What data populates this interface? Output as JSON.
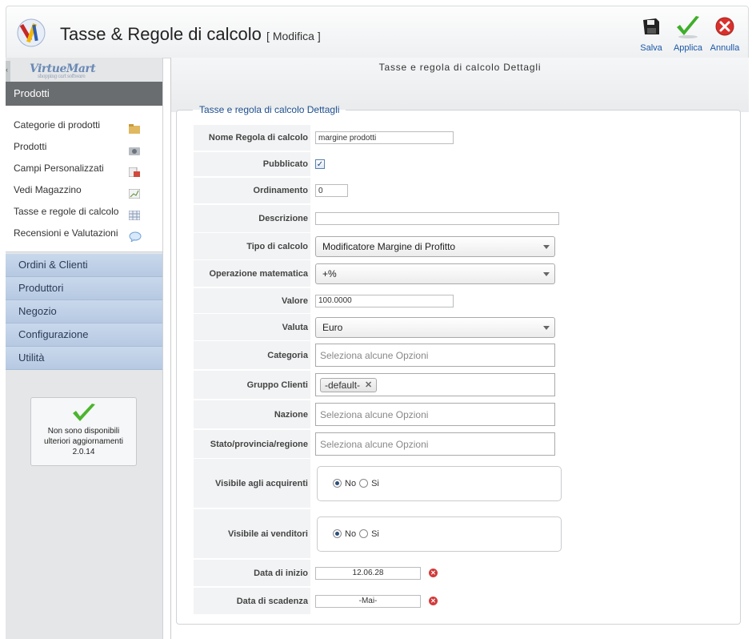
{
  "header": {
    "title": "Tasse & Regole di calcolo",
    "mode": "[ Modifica ]",
    "toolbar": {
      "save_label": "Salva",
      "apply_label": "Applica",
      "cancel_label": "Annulla"
    }
  },
  "sidebar": {
    "logo_text": "VirtueMart",
    "logo_tagline": "shopping cart software",
    "active_section": "Prodotti",
    "items": [
      {
        "label": "Categorie di prodotti",
        "icon": "folder-icon"
      },
      {
        "label": "Prodotti",
        "icon": "camera-icon"
      },
      {
        "label": "Campi Personalizzati",
        "icon": "custom-fields-icon"
      },
      {
        "label": "Vedi Magazzino",
        "icon": "chart-icon"
      },
      {
        "label": "Tasse e regole di calcolo",
        "icon": "calculator-icon"
      },
      {
        "label": "Recensioni e Valutazioni",
        "icon": "speech-bubble-icon"
      }
    ],
    "sections": [
      "Ordini & Clienti",
      "Produttori",
      "Negozio",
      "Configurazione",
      "Utilità"
    ],
    "update_box": {
      "line1": "Non sono disponibili",
      "line2": "ulteriori aggiornamenti",
      "version": "2.0.14"
    }
  },
  "main": {
    "heading": "Tasse e regola di calcolo Dettagli",
    "legend": "Tasse e regola di calcolo Dettagli",
    "form": {
      "name": {
        "label": "Nome Regola di calcolo",
        "value": "margine prodotti"
      },
      "published": {
        "label": "Pubblicato",
        "checked": true
      },
      "ordering": {
        "label": "Ordinamento",
        "value": "0"
      },
      "description": {
        "label": "Descrizione",
        "value": ""
      },
      "calc_type": {
        "label": "Tipo di calcolo",
        "value": "Modificatore Margine di Profitto"
      },
      "math_op": {
        "label": "Operazione matematica",
        "value": "+%"
      },
      "value": {
        "label": "Valore",
        "value": "100.0000"
      },
      "currency": {
        "label": "Valuta",
        "value": "Euro"
      },
      "category": {
        "label": "Categoria",
        "placeholder": "Seleziona alcune Opzioni"
      },
      "shopper_group": {
        "label": "Gruppo Clienti",
        "tag": "-default-"
      },
      "country": {
        "label": "Nazione",
        "placeholder": "Seleziona alcune Opzioni"
      },
      "state": {
        "label": "Stato/provincia/regione",
        "placeholder": "Seleziona alcune Opzioni"
      },
      "visible_shoppers": {
        "label": "Visibile agli acquirenti",
        "no": "No",
        "yes": "Si",
        "selected": "No"
      },
      "visible_vendors": {
        "label": "Visibile ai venditori",
        "no": "No",
        "yes": "Si",
        "selected": "No"
      },
      "start_date": {
        "label": "Data di inizio",
        "value": "12.06.28"
      },
      "end_date": {
        "label": "Data di scadenza",
        "value": "-Mai-"
      }
    }
  },
  "colors": {
    "link_blue": "#1b57a7",
    "legend_blue": "#1e4f8f",
    "section_blue": "#c9d8ec",
    "active_section": "#6a6d70"
  }
}
